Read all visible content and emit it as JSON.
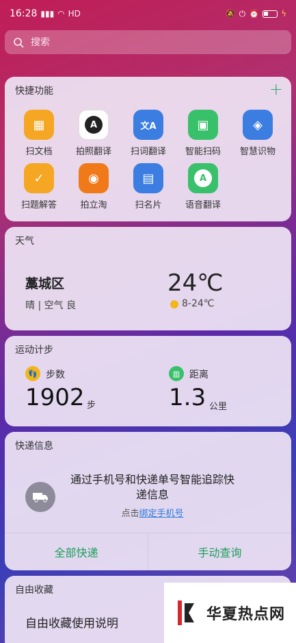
{
  "status": {
    "time": "16:28",
    "signal": "4G",
    "wifi_label": "HD"
  },
  "search": {
    "placeholder": "搜索"
  },
  "quick": {
    "title": "快捷功能",
    "add": "+",
    "items": [
      {
        "label": "扫文档",
        "icon": "scan-document-icon",
        "color": "#f5a623",
        "glyph": "▦"
      },
      {
        "label": "拍照翻译",
        "icon": "photo-translate-icon",
        "color": "#ffffff",
        "glyph": "A"
      },
      {
        "label": "扫词翻译",
        "icon": "word-translate-icon",
        "color": "#3b7de0",
        "glyph": "文A"
      },
      {
        "label": "智能扫码",
        "icon": "qr-scan-icon",
        "color": "#39c06a",
        "glyph": "▣"
      },
      {
        "label": "智慧识物",
        "icon": "object-recognition-icon",
        "color": "#3b7de0",
        "glyph": "◈"
      },
      {
        "label": "扫题解答",
        "icon": "question-answer-icon",
        "color": "#f5a623",
        "glyph": "✓"
      },
      {
        "label": "拍立淘",
        "icon": "camera-shop-icon",
        "color": "#f07a1a",
        "glyph": "◉"
      },
      {
        "label": "扫名片",
        "icon": "business-card-icon",
        "color": "#3b7de0",
        "glyph": "▤"
      },
      {
        "label": "语音翻译",
        "icon": "voice-translate-icon",
        "color": "#39c06a",
        "glyph": "A"
      }
    ]
  },
  "weather": {
    "title": "天气",
    "city": "藁城区",
    "desc": "晴 | 空气 良",
    "temp": "24℃",
    "range": "8-24℃"
  },
  "steps": {
    "title": "运动计步",
    "steps_label": "步数",
    "steps_value": "1902",
    "steps_unit": "步",
    "distance_label": "距离",
    "distance_value": "1.3",
    "distance_unit": "公里"
  },
  "express": {
    "title": "快递信息",
    "message": "通过手机号和快递单号智能追踪快递信息",
    "link_prefix": "点击",
    "link_text": "绑定手机号",
    "btn_all": "全部快递",
    "btn_query": "手动查询"
  },
  "favorites": {
    "title": "自由收藏",
    "item": "自由收藏使用说明"
  },
  "watermark": {
    "text": "华夏热点网"
  }
}
